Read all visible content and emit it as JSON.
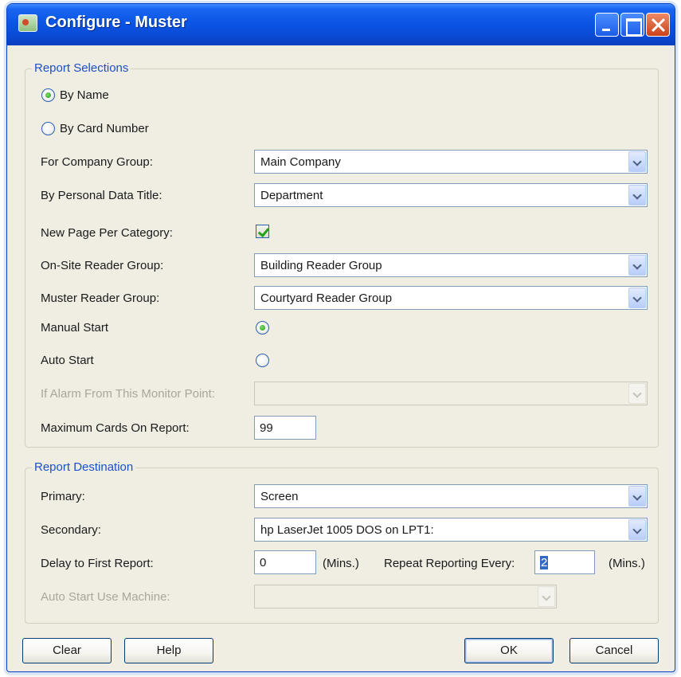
{
  "window": {
    "title": "Configure - Muster"
  },
  "report_selections": {
    "title": "Report Selections",
    "by_name_label": "By Name",
    "by_name_checked": true,
    "by_card_number_label": "By Card Number",
    "by_card_number_checked": false,
    "company_group_label": "For Company Group:",
    "company_group_value": "Main Company",
    "personal_data_title_label": "By Personal Data Title:",
    "personal_data_title_value": "Department",
    "new_page_label": "New Page Per Category:",
    "new_page_checked": true,
    "onsite_reader_label": "On-Site Reader Group:",
    "onsite_reader_value": "Building Reader Group",
    "muster_reader_label": "Muster Reader Group:",
    "muster_reader_value": "Courtyard Reader Group",
    "manual_start_label": "Manual Start",
    "manual_start_checked": true,
    "auto_start_label": "Auto Start",
    "auto_start_checked": false,
    "alarm_monitor_label": "If Alarm From This Monitor Point:",
    "alarm_monitor_value": "",
    "max_cards_label": "Maximum Cards On Report:",
    "max_cards_value": "99"
  },
  "report_destination": {
    "title": "Report Destination",
    "primary_label": "Primary:",
    "primary_value": "Screen",
    "secondary_label": "Secondary:",
    "secondary_value": "hp LaserJet 1005 DOS on LPT1:",
    "delay_label": "Delay to First Report:",
    "delay_value": "0",
    "delay_unit": "(Mins.)",
    "repeat_label": "Repeat Reporting Every:",
    "repeat_value": "2",
    "repeat_unit": "(Mins.)",
    "auto_start_machine_label": "Auto Start Use Machine:",
    "auto_start_machine_value": ""
  },
  "buttons": {
    "clear": "Clear",
    "help": "Help",
    "ok": "OK",
    "cancel": "Cancel"
  }
}
